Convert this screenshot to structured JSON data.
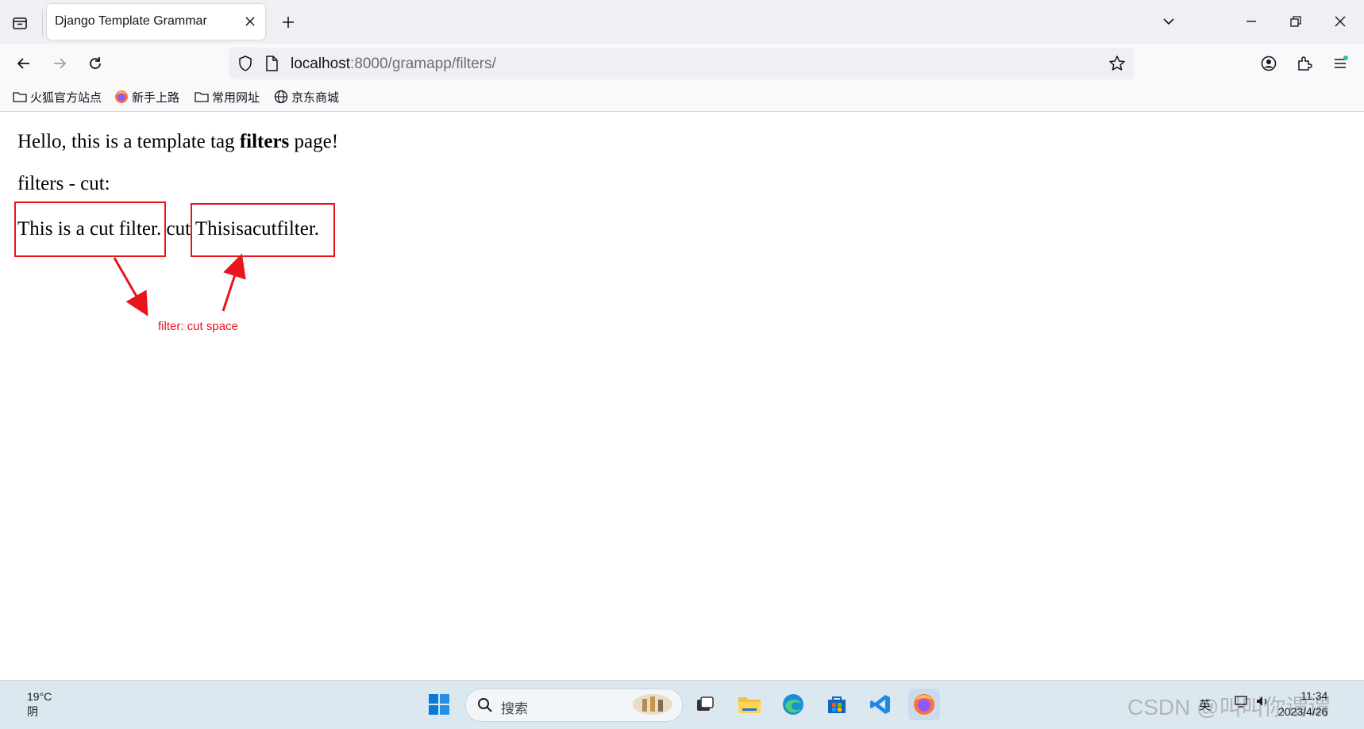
{
  "browser": {
    "tab_title": "Django Template Grammar",
    "url_host": "localhost",
    "url_rest": ":8000/gramapp/filters/",
    "bookmarks": [
      "火狐官方站点",
      "新手上路",
      "常用网址",
      "京东商城"
    ]
  },
  "page": {
    "line1_pre": "Hello, this is a template tag ",
    "line1_bold": "filters",
    "line1_post": " page!",
    "line2": "filters - cut:",
    "original_text": "This is a cut filter.",
    "middle_word": "cut",
    "cut_result": "Thisisacutfilter.",
    "annotation": "filter: cut space",
    "annotation_color": "#e8141e"
  },
  "taskbar": {
    "weather_temp": "19°C",
    "weather_desc": "阴",
    "search_placeholder": "搜索",
    "tray_lang": "英",
    "clock_time": "11:34",
    "clock_date": "2023/4/26",
    "watermark": "CSDN @叫叫你谓谓"
  }
}
